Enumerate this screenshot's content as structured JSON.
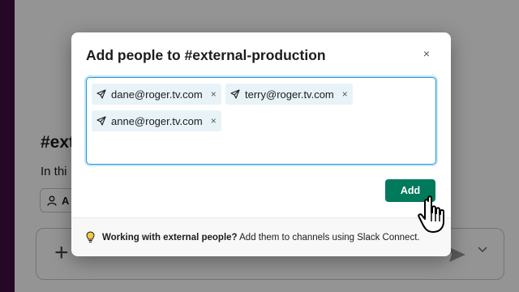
{
  "background": {
    "channel_heading": "#ext",
    "intro_text": "In thi",
    "chip_label": "A",
    "composer_plus": "+"
  },
  "modal": {
    "title": "Add people to #external-production",
    "close_glyph": "×",
    "recipients": [
      {
        "email": "dane@roger.tv.com",
        "remove": "×"
      },
      {
        "email": "terry@roger.tv.com",
        "remove": "×"
      },
      {
        "email": "anne@roger.tv.com",
        "remove": "×"
      }
    ],
    "add_label": "Add",
    "footer": {
      "bold_text": "Working with external people?",
      "text": " Add them to channels using Slack Connect."
    }
  },
  "colors": {
    "accent_green": "#007a5a",
    "focus_blue": "#1d9bd1",
    "token_bg": "#e8f3f8",
    "sidebar": "#3f0e40"
  },
  "icons": {
    "token_icon": "paper-plane-icon",
    "footer_icon": "lightbulb-icon",
    "cursor": "hand-pointer-icon"
  }
}
